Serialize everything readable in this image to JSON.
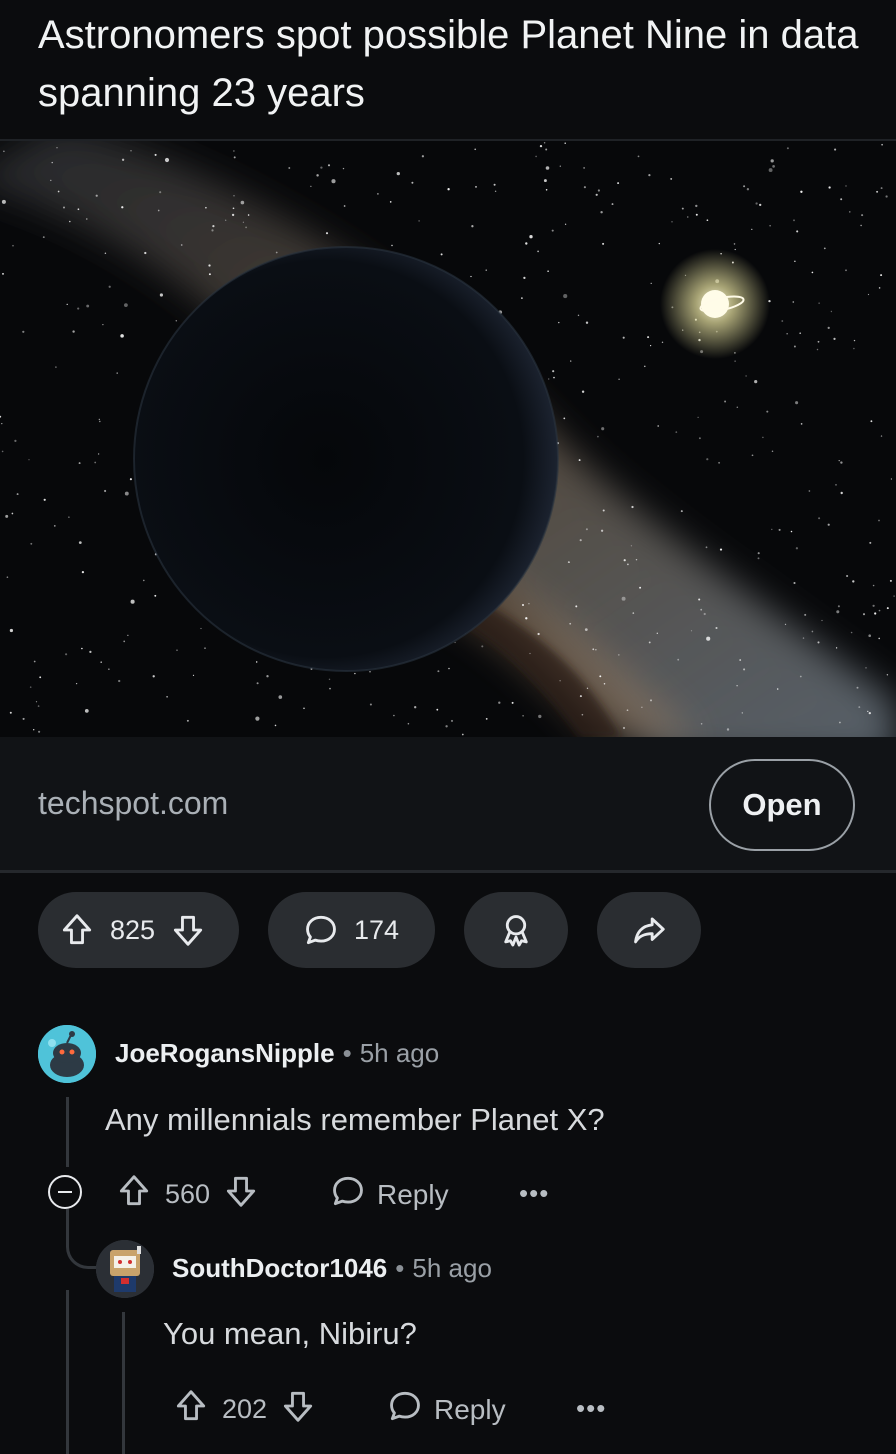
{
  "post": {
    "title": "Astronomers spot possible Planet Nine in data spanning 23 years",
    "link_domain": "techspot.com",
    "open_label": "Open",
    "upvotes": "825",
    "comments": "174"
  },
  "comments": [
    {
      "username": "JoeRogansNipple",
      "separator": "•",
      "time": "5h ago",
      "text": "Any millennials remember Planet X?",
      "score": "560",
      "reply_label": "Reply",
      "more_label": "•••",
      "avatar_color": "#4fc3d9"
    },
    {
      "username": "SouthDoctor1046",
      "separator": "•",
      "time": "5h ago",
      "text": "You mean, Nibiru?",
      "score": "202",
      "reply_label": "Reply",
      "more_label": "•••",
      "avatar_color": "#3a3f46"
    }
  ],
  "icons": {
    "upvote": "arrow-up-icon",
    "downvote": "arrow-down-icon",
    "comment": "speech-bubble-icon",
    "award": "award-icon",
    "share": "share-arrow-icon",
    "collapse": "minus-circle-icon",
    "more": "ellipsis-icon"
  },
  "colors": {
    "background": "#0b0c0e",
    "pill": "#2a2d31",
    "thread_line": "#33373c"
  }
}
